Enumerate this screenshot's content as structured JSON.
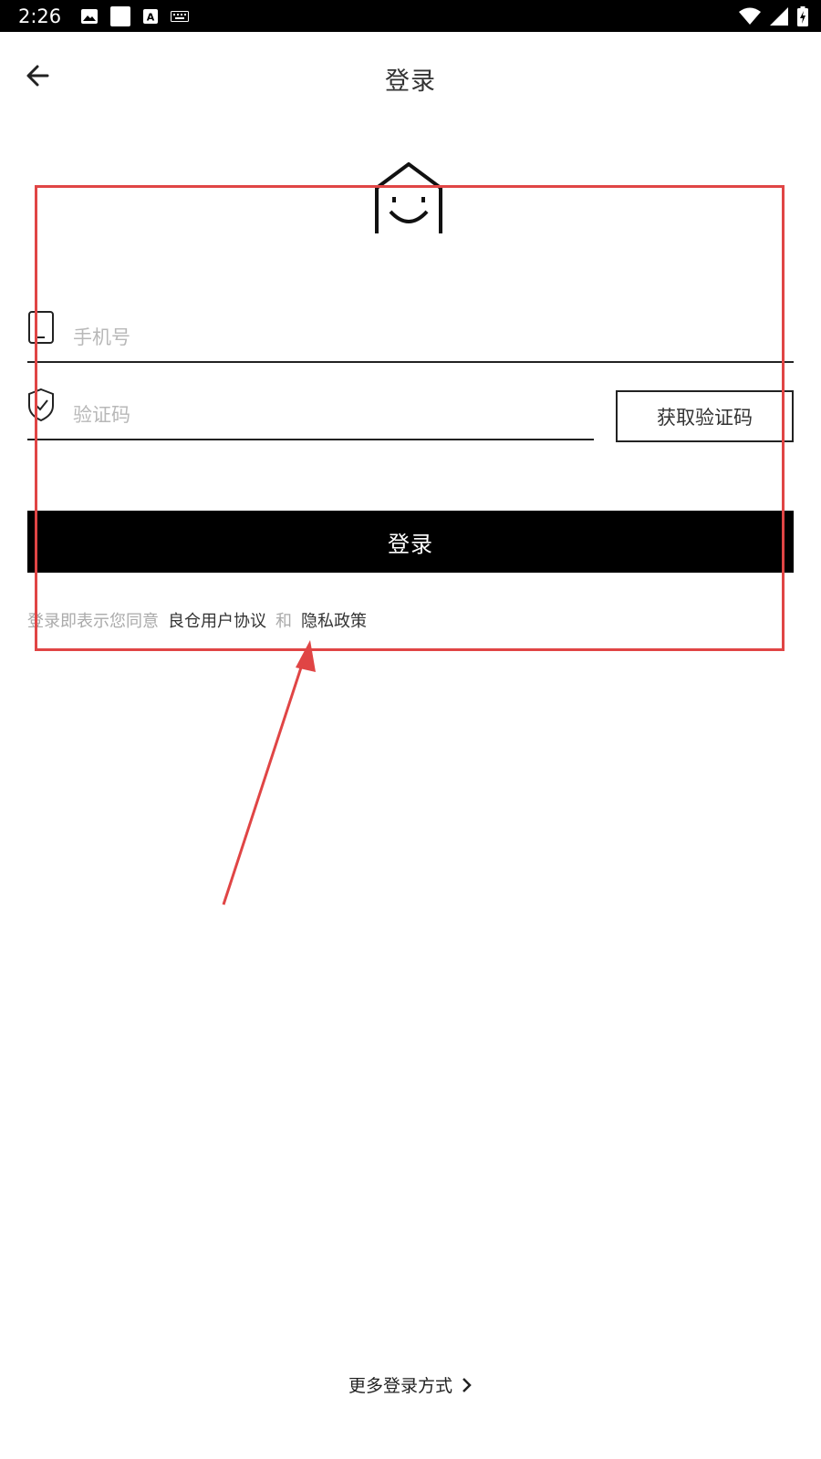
{
  "status_bar": {
    "time": "2:26",
    "left_icons": [
      "image-icon",
      "square-icon",
      "text-a-icon",
      "keyboard-icon"
    ],
    "right_icons": [
      "wifi-icon",
      "signal-icon",
      "battery-charging-icon"
    ]
  },
  "app_bar": {
    "back_icon": "arrow-left-icon",
    "title": "登录"
  },
  "logo": {
    "icon": "house-smile-logo"
  },
  "phone_field": {
    "icon": "phone-icon",
    "placeholder": "手机号",
    "value": ""
  },
  "code_field": {
    "icon": "shield-check-icon",
    "placeholder": "验证码",
    "value": ""
  },
  "get_code_button": {
    "label": "获取验证码"
  },
  "login_button": {
    "label": "登录"
  },
  "agreement": {
    "prefix": "登录即表示您同意",
    "user_agreement": "良仓用户协议",
    "conjunction": "和",
    "privacy_policy": "隐私政策"
  },
  "more_login": {
    "label": "更多登录方式",
    "icon": "chevron-right-icon"
  },
  "colors": {
    "primary": "#000000",
    "annotation": "#e04545",
    "placeholder": "#b8b8b8",
    "muted_text": "#aaaaaa"
  }
}
